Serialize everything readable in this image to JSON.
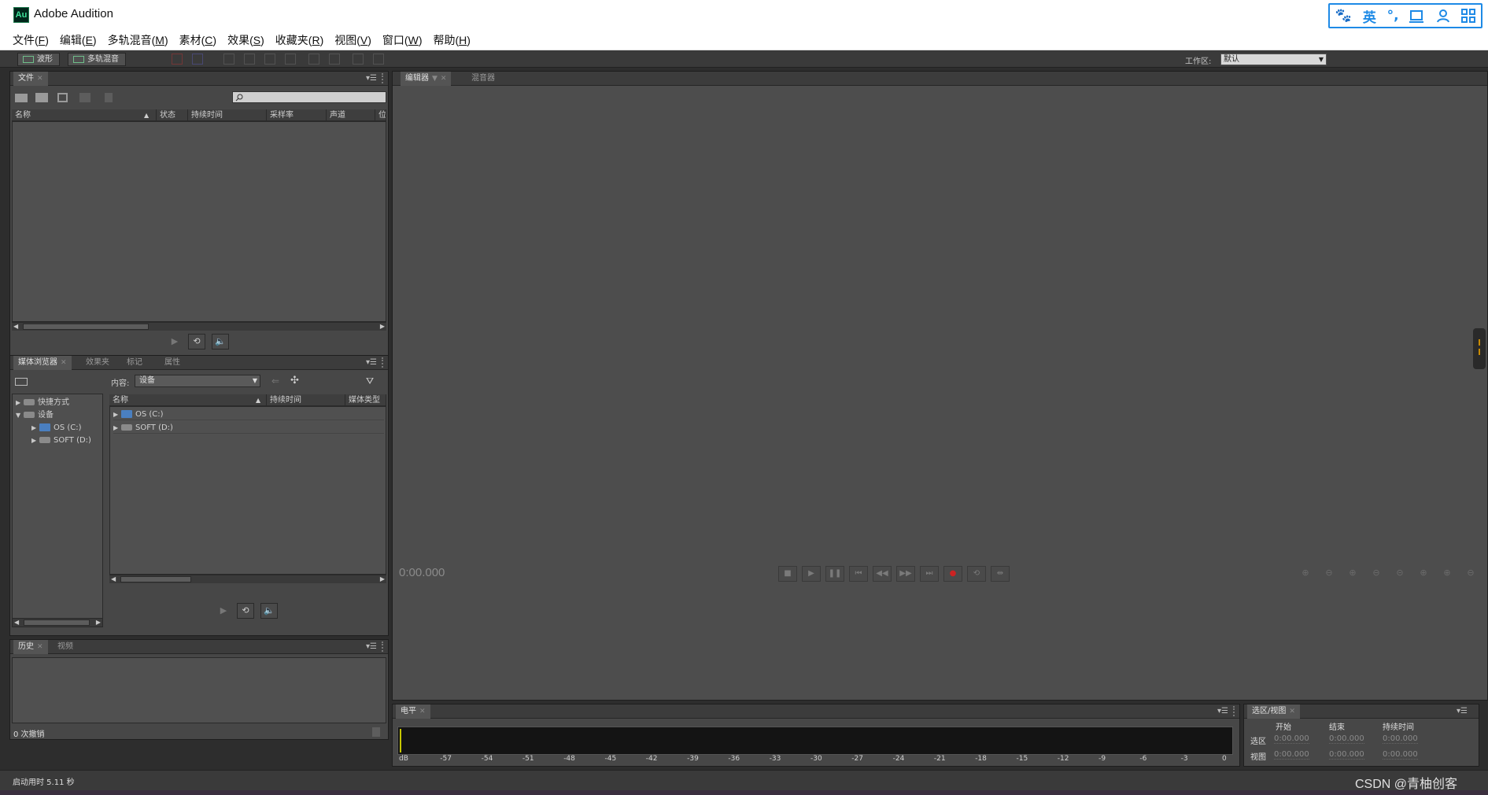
{
  "window": {
    "title": "Adobe Audition",
    "icon": "Au"
  },
  "menus": [
    {
      "label": "文件(",
      "key": "F",
      "tail": ")"
    },
    {
      "label": "编辑(",
      "key": "E",
      "tail": ")"
    },
    {
      "label": "多轨混音(",
      "key": "M",
      "tail": ")"
    },
    {
      "label": "素材(",
      "key": "C",
      "tail": ")"
    },
    {
      "label": "效果(",
      "key": "S",
      "tail": ")"
    },
    {
      "label": "收藏夹(",
      "key": "R",
      "tail": ")"
    },
    {
      "label": "视图(",
      "key": "V",
      "tail": ")"
    },
    {
      "label": "窗口(",
      "key": "W",
      "tail": ")"
    },
    {
      "label": "帮助(",
      "key": "H",
      "tail": ")"
    }
  ],
  "toolbar": {
    "waveform": "波形",
    "multitrack": "多轨混音",
    "workspace_label": "工作区:",
    "workspace_value": "默认"
  },
  "ime": {
    "mode": "英",
    "punct": "°,"
  },
  "files_panel": {
    "tab": "文件",
    "columns": [
      "名称",
      "状态",
      "持续时间",
      "采样率",
      "声道",
      "位"
    ]
  },
  "media_panel": {
    "tabs": [
      "媒体浏览器",
      "效果夹",
      "标记",
      "属性"
    ],
    "content_label": "内容:",
    "content_value": "设备",
    "tree": [
      {
        "label": "快捷方式",
        "level": 0,
        "open": false
      },
      {
        "label": "设备",
        "level": 0,
        "open": true
      },
      {
        "label": "OS (C:)",
        "level": 1,
        "open": false
      },
      {
        "label": "SOFT (D:)",
        "level": 1,
        "open": false
      }
    ],
    "columns": [
      "名称",
      "持续时间",
      "媒体类型"
    ],
    "rows": [
      "OS (C:)",
      "SOFT (D:)"
    ]
  },
  "history_panel": {
    "tabs": [
      "历史",
      "视频"
    ],
    "undo_count": "0 次撤销"
  },
  "editor": {
    "tabs": [
      "编辑器",
      "混音器"
    ],
    "time": "0:00.000"
  },
  "levels": {
    "tab": "电平",
    "ticks": [
      "dB",
      "-57",
      "-54",
      "-51",
      "-48",
      "-45",
      "-42",
      "-39",
      "-36",
      "-33",
      "-30",
      "-27",
      "-24",
      "-21",
      "-18",
      "-15",
      "-12",
      "-9",
      "-6",
      "-3",
      "0"
    ]
  },
  "selection_panel": {
    "tab": "选区/视图",
    "headers": [
      "开始",
      "结束",
      "持续时间"
    ],
    "rows": [
      {
        "label": "选区",
        "values": [
          "0:00.000",
          "0:00.000",
          "0:00.000"
        ]
      },
      {
        "label": "视图",
        "values": [
          "0:00.000",
          "0:00.000",
          "0:00.000"
        ]
      }
    ]
  },
  "status": {
    "startup": "启动用时 5.11 秒"
  },
  "watermark": "CSDN @青柚创客"
}
